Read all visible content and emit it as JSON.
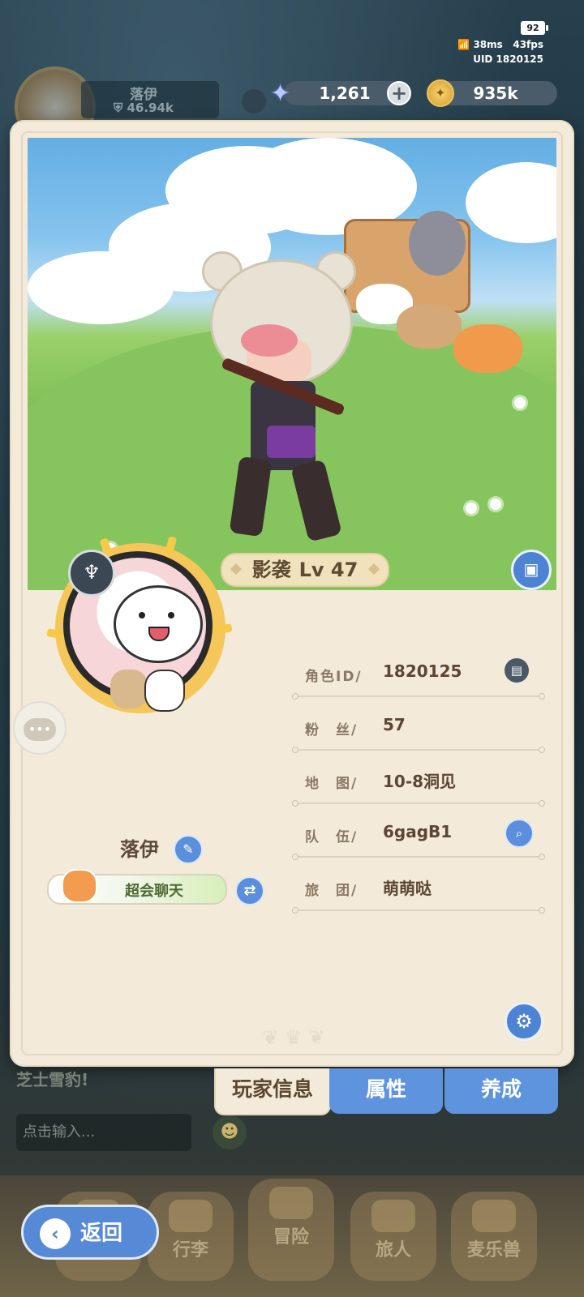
{
  "status": {
    "battery": "92",
    "ping": "38ms",
    "fps": "43fps",
    "uid": "UID 1820125"
  },
  "hud": {
    "player_name": "落伊",
    "power": "46.94k",
    "gems": "1,261",
    "coins": "935k"
  },
  "scene": {
    "role": "影袭",
    "level": "Lv 47"
  },
  "profile": {
    "name": "落伊",
    "title": "超会聊天",
    "rows": [
      {
        "key": "角色ID/",
        "value": "1820125"
      },
      {
        "key": "粉　丝/",
        "value": "57"
      },
      {
        "key": "地　图/",
        "value": "10-8洞见"
      },
      {
        "key": "队　伍/",
        "value": "6gagB1"
      },
      {
        "key": "旅　团/",
        "value": "萌萌哒"
      }
    ]
  },
  "tabs": {
    "player_info": "玩家信息",
    "attributes": "属性",
    "training": "养成"
  },
  "chat": {
    "last_message": "芝士雪豹!",
    "input_placeholder": "点击输入..."
  },
  "nav": {
    "back": "返回",
    "luggage": "行李",
    "adventure": "冒险",
    "traveler": "旅人",
    "beast": "麦乐兽"
  },
  "colors": {
    "accent_blue": "#5e94de",
    "panel": "#f3ead9",
    "text_brown": "#5b4632"
  }
}
